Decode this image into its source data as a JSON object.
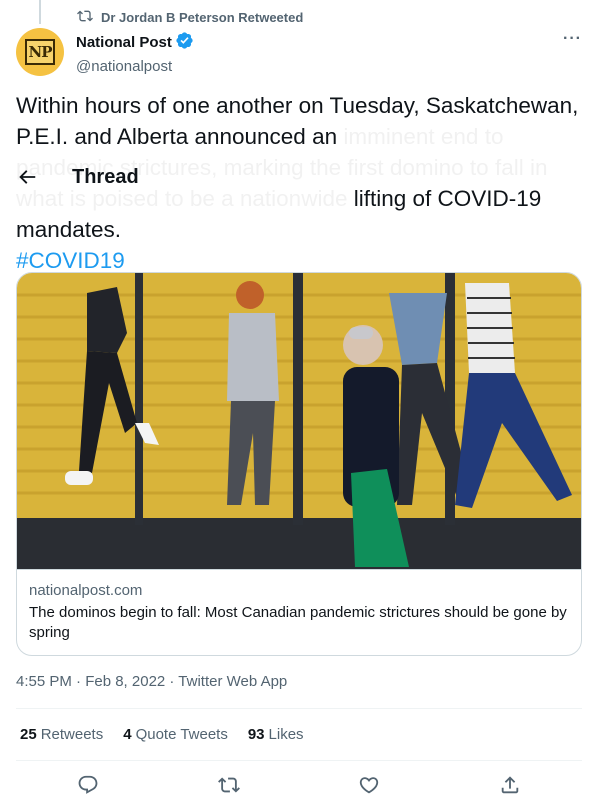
{
  "retweet_context": {
    "label": "Dr Jordan B Peterson Retweeted",
    "icon": "retweet-icon"
  },
  "author": {
    "avatar_text": "NP",
    "name": "National Post",
    "handle": "@nationalpost",
    "verified_icon": "verified-badge-icon"
  },
  "more_label": "···",
  "tweet": {
    "line1": "Within hours of one another on Tuesday, Saskatchewan, P.E.I. and Alberta announced an",
    "faded": "imminent end to pandemic strictures, marking the first domino to fall in what is poised to be a nationwide",
    "line_end": "lifting of COVID-19 mandates.",
    "hashtag": "#COVID19"
  },
  "thread_header": {
    "title": "Thread",
    "back_icon": "back-arrow-icon"
  },
  "card": {
    "domain": "nationalpost.com",
    "title": "The dominos begin to fall: Most Canadian pandemic strictures should be gone by spring"
  },
  "timestamp": "4:55 PM · Feb 8, 2022 · Twitter Web App",
  "stats": {
    "retweets_count": "25",
    "retweets_label": "Retweets",
    "quotes_count": "4",
    "quotes_label": "Quote Tweets",
    "likes_count": "93",
    "likes_label": "Likes"
  },
  "colors": {
    "accent": "#1d9bf0",
    "text": "#0f1419",
    "secondary": "#536471",
    "border": "#cfd9de"
  }
}
